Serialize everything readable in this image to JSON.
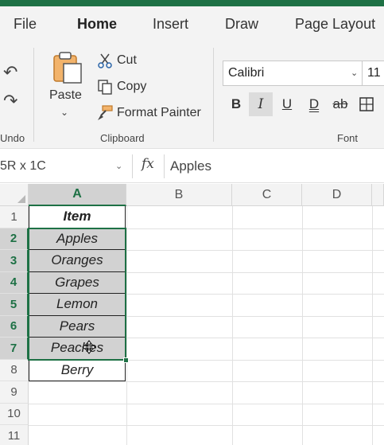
{
  "tabs": [
    {
      "label": "File"
    },
    {
      "label": "Home"
    },
    {
      "label": "Insert"
    },
    {
      "label": "Draw"
    },
    {
      "label": "Page Layout"
    }
  ],
  "ribbon": {
    "undo_group_label": "Undo",
    "clipboard": {
      "group_label": "Clipboard",
      "paste_label": "Paste",
      "cut_label": "Cut",
      "copy_label": "Copy",
      "format_painter_label": "Format Painter"
    },
    "font": {
      "group_label": "Font",
      "font_name": "Calibri",
      "font_size": "11",
      "bold_label": "B",
      "italic_label": "I",
      "underline_label": "U",
      "double_underline_label": "D",
      "strikethrough_label": "ab"
    }
  },
  "formula_bar": {
    "name_box": "5R x 1C",
    "fx_label": "fx",
    "value": "Apples"
  },
  "sheet": {
    "columns": [
      "A",
      "B",
      "C",
      "D"
    ],
    "rows": [
      "1",
      "2",
      "3",
      "4",
      "5",
      "6",
      "7",
      "8",
      "9",
      "10",
      "11"
    ],
    "cells_a": [
      "Item",
      "Apples",
      "Oranges",
      "Grapes",
      "Lemon",
      "Pears",
      "Peaches",
      "Berry"
    ]
  },
  "colors": {
    "accent": "#1e7145",
    "selection_fill": "#d2d2d2",
    "ribbon_bg": "#f3f3f3"
  }
}
